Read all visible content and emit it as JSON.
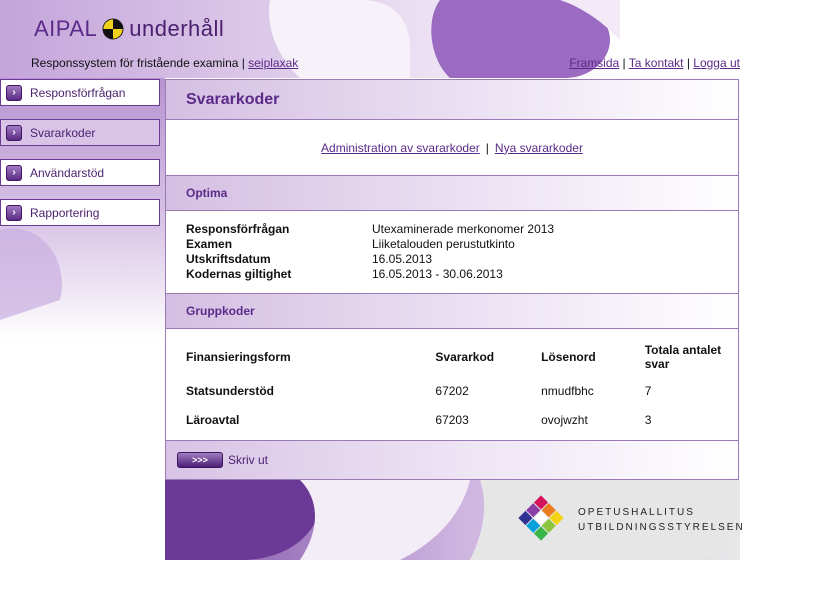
{
  "header": {
    "app_name": "AIPAL",
    "app_name_suffix": "underhåll",
    "subtitle": "Responssystem för fristående examina |",
    "user": "seiplaxak",
    "links": [
      "Framsida",
      "Ta kontakt",
      "Logga ut"
    ]
  },
  "sidebar": {
    "items": [
      {
        "label": "Responsförfrågan",
        "active": false
      },
      {
        "label": "Svararkoder",
        "active": true
      },
      {
        "label": "Användarstöd",
        "active": false
      },
      {
        "label": "Rapportering",
        "active": false
      }
    ]
  },
  "main": {
    "title": "Svararkoder",
    "admin_links": [
      "Administration av svararkoder",
      "Nya svararkoder"
    ],
    "admin_separator": "|",
    "optima": {
      "heading": "Optima",
      "rows": [
        {
          "key": "Responsförfrågan",
          "value": "Utexaminerade merkonomer 2013"
        },
        {
          "key": "Examen",
          "value": "Liiketalouden perustutkinto"
        },
        {
          "key": "Utskriftsdatum",
          "value": "16.05.2013"
        },
        {
          "key": "Kodernas giltighet",
          "value": "16.05.2013 - 30.06.2013"
        }
      ]
    },
    "gruppkoder": {
      "heading": "Gruppkoder",
      "columns": [
        "Finansieringsform",
        "Svararkod",
        "Lösenord",
        "Totala antalet svar"
      ],
      "rows": [
        {
          "form": "Statsunderstöd",
          "code": "67202",
          "password": "nmudfbhc",
          "total": "7"
        },
        {
          "form": "Läroavtal",
          "code": "67203",
          "password": "ovojwzht",
          "total": "3"
        }
      ]
    },
    "print_button": ">>>",
    "print_label": "Skriv ut"
  },
  "footer": {
    "org_line1": "OPETUSHALLITUS",
    "org_line2": "UTBILDNINGSSTYRELSEN"
  },
  "colors": {
    "brand_purple": "#5c2a88",
    "light_purple": "#d9c3e6"
  }
}
